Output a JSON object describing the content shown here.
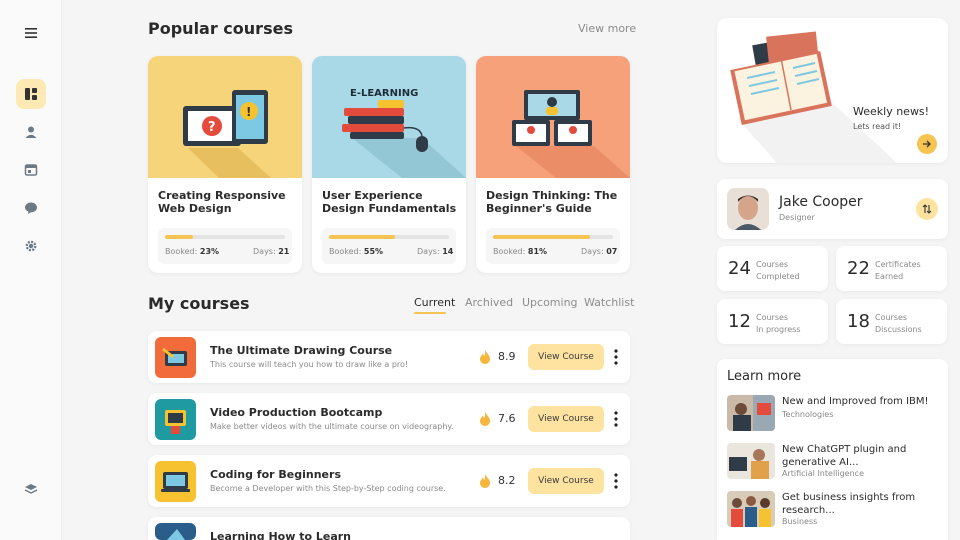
{
  "sidebar": {
    "items": [
      {
        "icon": "menu-icon"
      },
      {
        "icon": "dashboard-icon",
        "active": true
      },
      {
        "icon": "user-icon"
      },
      {
        "icon": "calendar-icon"
      },
      {
        "icon": "chat-icon"
      },
      {
        "icon": "gear-icon"
      },
      {
        "icon": "layers-icon"
      }
    ],
    "active_color": "#fde9b3"
  },
  "popular": {
    "title": "Popular courses",
    "view_more": "View more",
    "booked_label": "Booked:",
    "days_label": "Days:",
    "courses": [
      {
        "title": "Creating Responsive Web Design",
        "booked": "23%",
        "booked_progress": 0.23,
        "days": "21",
        "thumb_color": "#f6d47a"
      },
      {
        "title": "User Experience Design Fundamentals",
        "booked": "55%",
        "booked_progress": 0.55,
        "days": "14",
        "thumb_color": "#a9d8e6",
        "thumb_text": "E-LEARNING"
      },
      {
        "title": "Design Thinking: The Beginner's Guide",
        "booked": "81%",
        "booked_progress": 0.81,
        "days": "07",
        "thumb_color": "#f7a17a"
      }
    ]
  },
  "my_courses": {
    "title": "My courses",
    "tabs": [
      "Current",
      "Archived",
      "Upcoming",
      "Watchlist"
    ],
    "active_tab": "Current",
    "button_label": "View Course",
    "rows": [
      {
        "title": "The Ultimate Drawing Course",
        "desc": "This course will teach you how to draw like a pro!",
        "rating": "8.9",
        "icon_color": "#f26b3a"
      },
      {
        "title": "Video Production Bootcamp",
        "desc": "Make better videos with the ultimate course on videography.",
        "rating": "7.6",
        "icon_color": "#1f9aa0"
      },
      {
        "title": "Coding for Beginners",
        "desc": "Become a Developer with this Step-by-Step coding course.",
        "rating": "8.2",
        "icon_color": "#f6c22f"
      },
      {
        "title": "Learning How to Learn",
        "desc": "",
        "rating": "",
        "icon_color": "#2b5d8a"
      }
    ]
  },
  "news": {
    "title": "Weekly news!",
    "subtitle": "Lets read it!"
  },
  "profile": {
    "name": "Jake Cooper",
    "role": "Designer"
  },
  "stats": [
    {
      "value": "24",
      "label_line1": "Courses",
      "label_line2": "Completed"
    },
    {
      "value": "22",
      "label_line1": "Certificates",
      "label_line2": "Earned"
    },
    {
      "value": "12",
      "label_line1": "Courses",
      "label_line2": "In progress"
    },
    {
      "value": "18",
      "label_line1": "Courses",
      "label_line2": "Discussions"
    }
  ],
  "learn_more": {
    "title": "Learn more",
    "items": [
      {
        "title": "New and Improved from IBM!",
        "tag": "Technologies"
      },
      {
        "title": "New ChatGPT plugin and generative AI...",
        "tag": "Artificial Intelligence"
      },
      {
        "title": "Get business insights from research...",
        "tag": "Business"
      }
    ]
  },
  "colors": {
    "accent": "#f6c453",
    "accent_light": "#fde2a0",
    "background": "#f5f5f5"
  }
}
